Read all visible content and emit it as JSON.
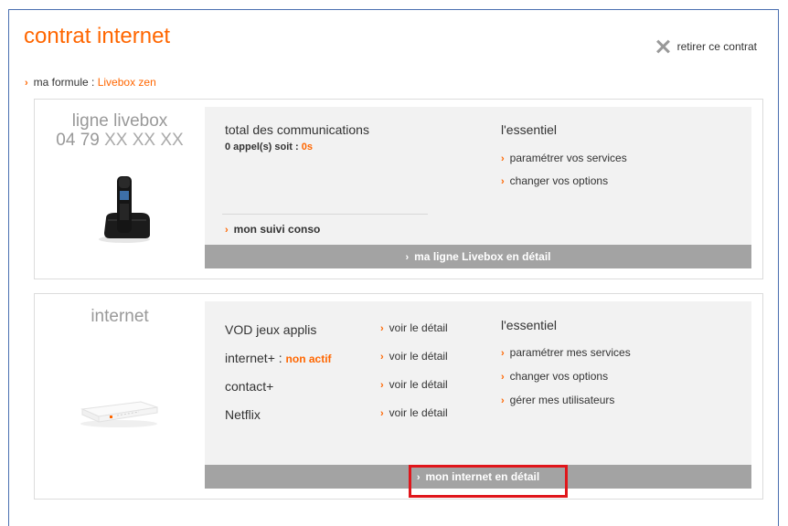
{
  "header": {
    "title": "contrat internet",
    "remove_label": "retirer ce contrat",
    "formula_label": "ma formule : ",
    "formula_value": "Livebox zen"
  },
  "line_panel": {
    "title_line1": "ligne livebox",
    "number_prefix": "04 79",
    "number_masked": "XX XX XX",
    "communications_title": "total des communications",
    "calls_text": "0 appel(s) soit : ",
    "calls_amount": "0s",
    "essentials_title": "l'essentiel",
    "links": [
      "paramétrer vos services",
      "changer vos options"
    ],
    "suivi_label": "mon suivi conso",
    "detail_bar": "ma ligne Livebox en détail"
  },
  "internet_panel": {
    "title": "internet",
    "services": [
      {
        "name": "VOD jeux applis",
        "status": "",
        "link": "voir le détail"
      },
      {
        "name": "internet+ : ",
        "status": "non actif",
        "link": "voir le détail"
      },
      {
        "name": "contact+",
        "status": "",
        "link": "voir le détail"
      },
      {
        "name": "Netflix",
        "status": "",
        "link": "voir le détail"
      }
    ],
    "essentials_title": "l'essentiel",
    "links": [
      "paramétrer mes services",
      "changer vos options",
      "gérer mes utilisateurs"
    ],
    "detail_bar": "mon internet en détail"
  },
  "colors": {
    "accent": "#ff6600",
    "bar": "#a3a3a3",
    "highlight": "#e0161b",
    "frame": "#4a6fb0"
  }
}
